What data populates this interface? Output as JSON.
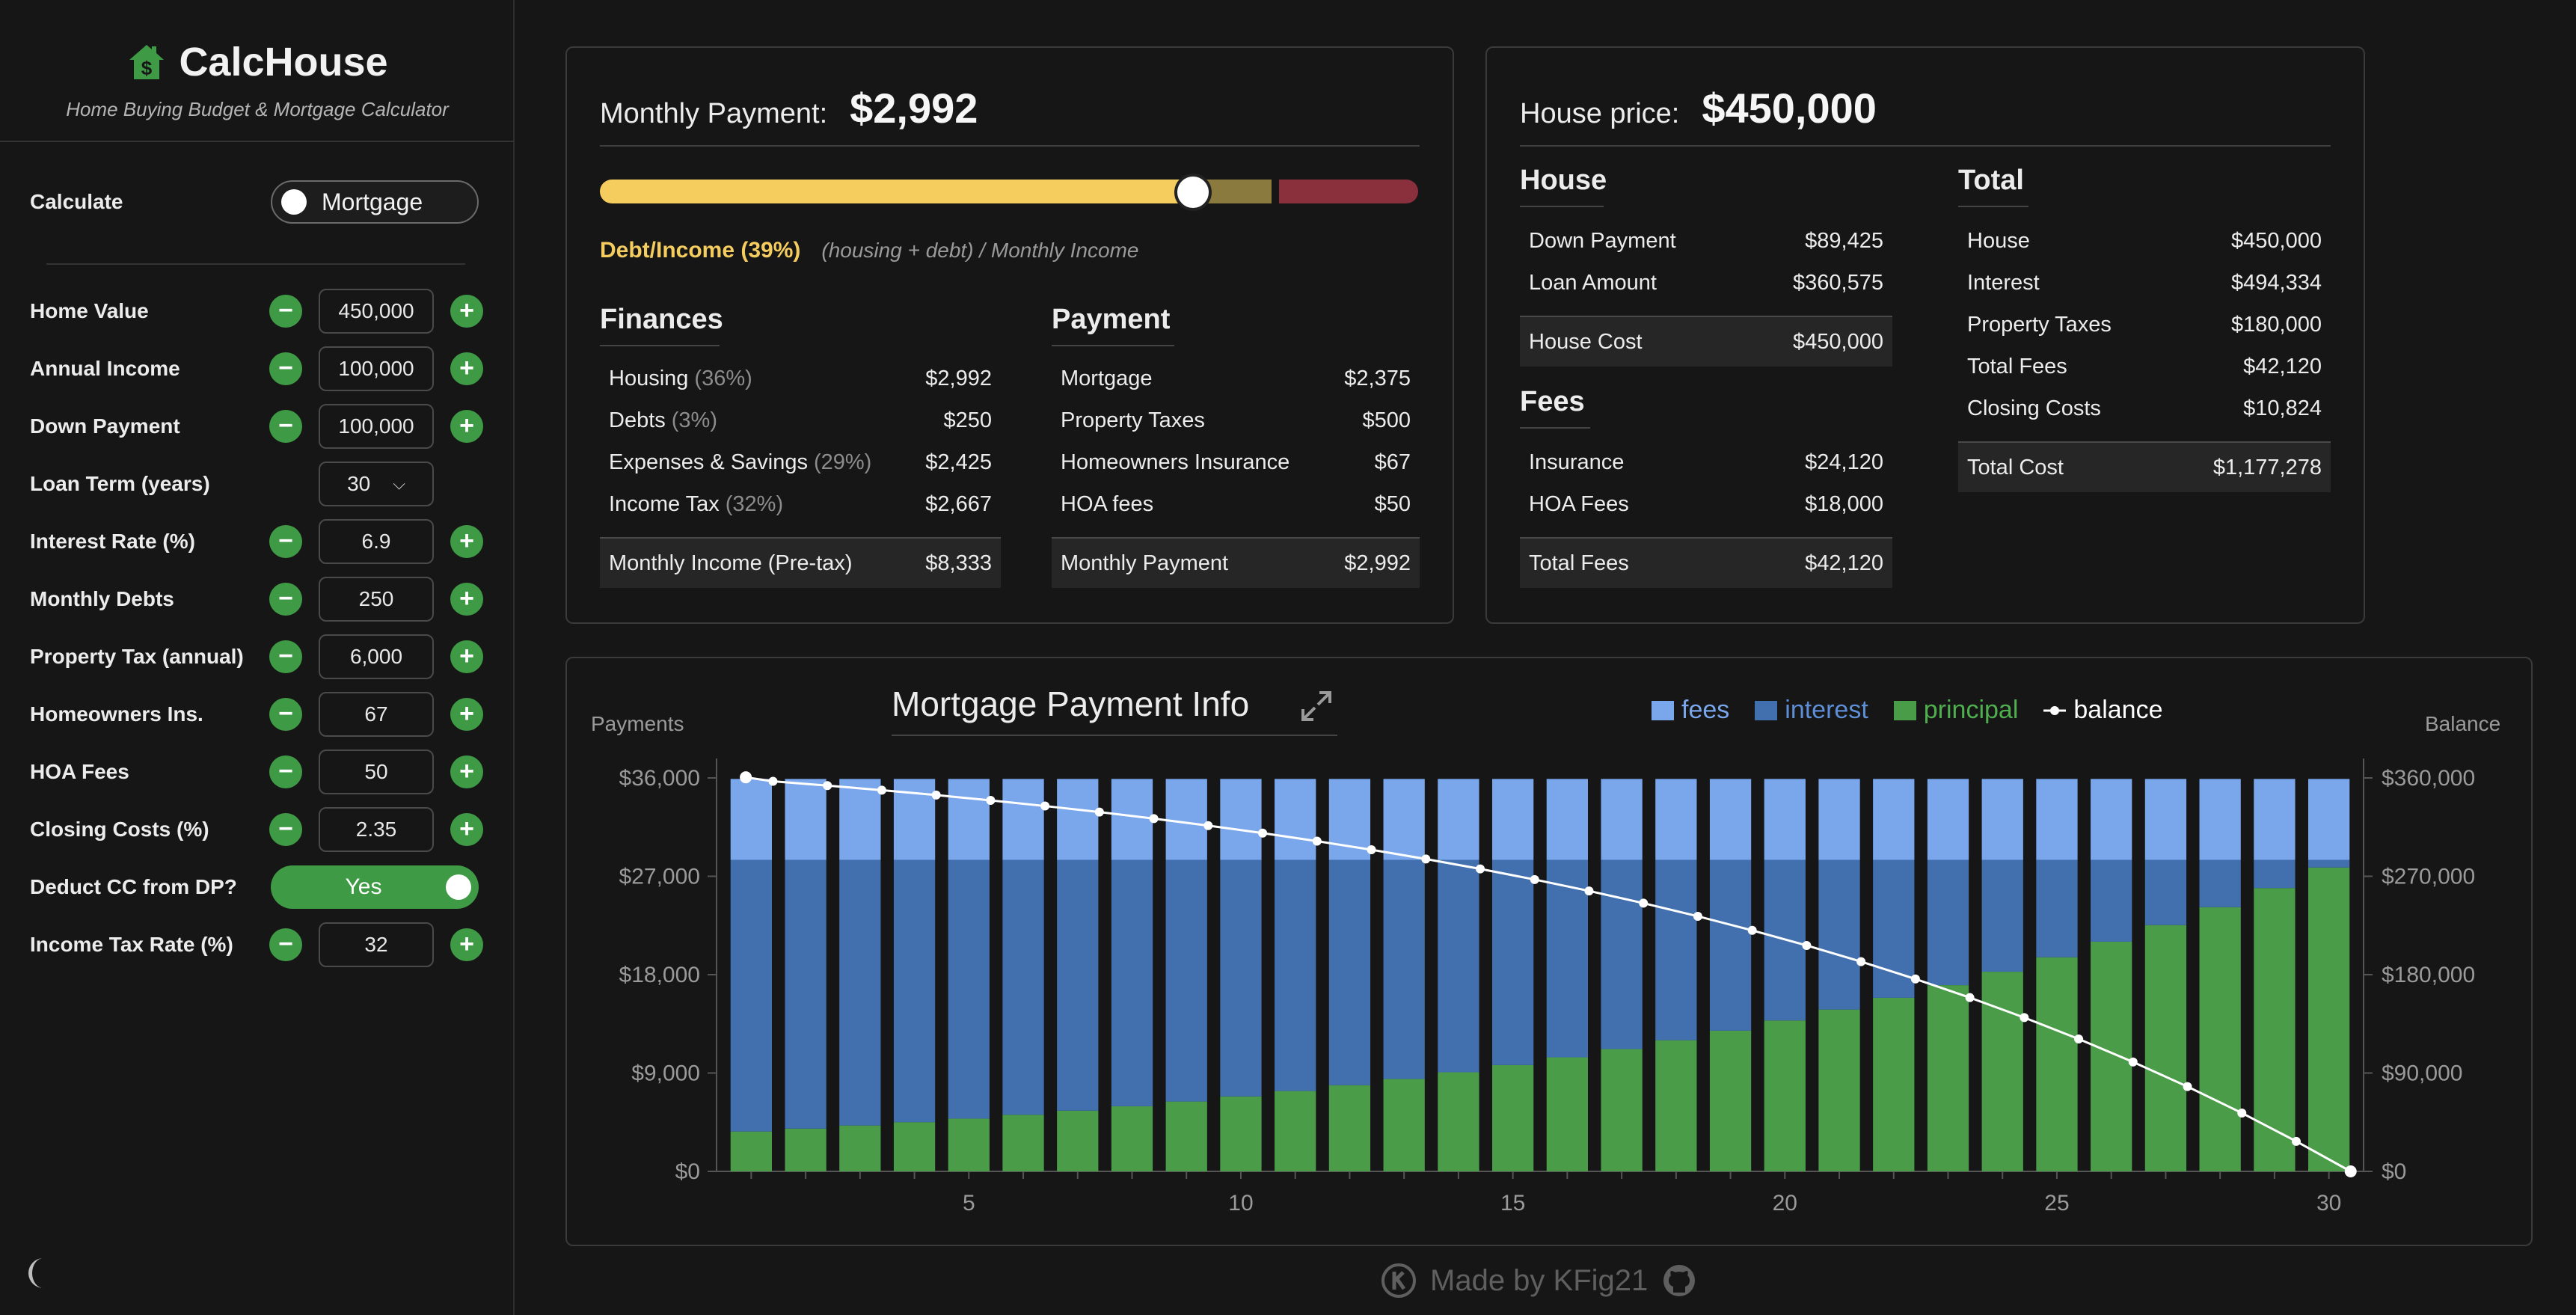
{
  "brand": {
    "name": "CalcHouse",
    "subtitle": "Home Buying Budget & Mortgage Calculator"
  },
  "sidebar": {
    "calculate": {
      "label": "Calculate",
      "mode": "Mortgage"
    },
    "fields": {
      "home_value": {
        "label": "Home Value",
        "value": "450,000"
      },
      "annual_income": {
        "label": "Annual Income",
        "value": "100,000"
      },
      "down_payment": {
        "label": "Down Payment",
        "value": "100,000"
      },
      "loan_term": {
        "label": "Loan Term (years)",
        "value": "30"
      },
      "interest_rate": {
        "label": "Interest Rate (%)",
        "value": "6.9"
      },
      "monthly_debts": {
        "label": "Monthly Debts",
        "value": "250"
      },
      "property_tax": {
        "label": "Property Tax (annual)",
        "value": "6,000"
      },
      "homeowners_ins": {
        "label": "Homeowners Ins.",
        "value": "67"
      },
      "hoa_fees": {
        "label": "HOA Fees",
        "value": "50"
      },
      "closing_costs": {
        "label": "Closing Costs (%)",
        "value": "2.35"
      },
      "deduct_cc": {
        "label": "Deduct CC from DP?",
        "value": "Yes"
      },
      "income_tax_rate": {
        "label": "Income Tax Rate (%)",
        "value": "32"
      }
    }
  },
  "payment_panel": {
    "label": "Monthly Payment:",
    "value": "$2,992",
    "dti_label": "Debt/Income (39%)",
    "dti_note": "(housing + debt) / Monthly Income",
    "dti_percent": 39,
    "finances": {
      "title": "Finances",
      "rows": [
        {
          "label": "Housing",
          "pct": "(36%)",
          "value": "$2,992"
        },
        {
          "label": "Debts",
          "pct": "(3%)",
          "value": "$250"
        },
        {
          "label": "Expenses & Savings",
          "pct": "(29%)",
          "value": "$2,425"
        },
        {
          "label": "Income Tax",
          "pct": "(32%)",
          "value": "$2,667"
        }
      ],
      "total": {
        "label": "Monthly Income (Pre-tax)",
        "value": "$8,333"
      }
    },
    "payment": {
      "title": "Payment",
      "rows": [
        {
          "label": "Mortgage",
          "value": "$2,375"
        },
        {
          "label": "Property Taxes",
          "value": "$500"
        },
        {
          "label": "Homeowners Insurance",
          "value": "$67"
        },
        {
          "label": "HOA fees",
          "value": "$50"
        }
      ],
      "total": {
        "label": "Monthly Payment",
        "value": "$2,992"
      }
    }
  },
  "house_panel": {
    "label": "House price:",
    "value": "$450,000",
    "house": {
      "title": "House",
      "rows": [
        {
          "label": "Down Payment",
          "value": "$89,425"
        },
        {
          "label": "Loan Amount",
          "value": "$360,575"
        }
      ],
      "total": {
        "label": "House Cost",
        "value": "$450,000"
      }
    },
    "fees": {
      "title": "Fees",
      "rows": [
        {
          "label": "Insurance",
          "value": "$24,120"
        },
        {
          "label": "HOA Fees",
          "value": "$18,000"
        }
      ],
      "total": {
        "label": "Total Fees",
        "value": "$42,120"
      }
    },
    "total": {
      "title": "Total",
      "rows": [
        {
          "label": "House",
          "value": "$450,000"
        },
        {
          "label": "Interest",
          "value": "$494,334"
        },
        {
          "label": "Property Taxes",
          "value": "$180,000"
        },
        {
          "label": "Total Fees",
          "value": "$42,120"
        },
        {
          "label": "Closing Costs",
          "value": "$10,824"
        }
      ],
      "total": {
        "label": "Total Cost",
        "value": "$1,177,278"
      }
    }
  },
  "chart": {
    "title": "Mortgage Payment Info",
    "left_axis_title": "Payments",
    "right_axis_title": "Balance",
    "legend": [
      {
        "name": "fees",
        "color": "#7aa7ec"
      },
      {
        "name": "interest",
        "color": "#426fae"
      },
      {
        "name": "principal",
        "color": "#4a9c49"
      },
      {
        "name": "balance",
        "color": "#ffffff"
      }
    ]
  },
  "chart_data": {
    "type": "bar",
    "stacked": true,
    "x": [
      1,
      2,
      3,
      4,
      5,
      6,
      7,
      8,
      9,
      10,
      11,
      12,
      13,
      14,
      15,
      16,
      17,
      18,
      19,
      20,
      21,
      22,
      23,
      24,
      25,
      26,
      27,
      28,
      29,
      30
    ],
    "x_ticks": [
      "5",
      "10",
      "15",
      "20",
      "25",
      "30"
    ],
    "y_left_ticks": [
      "$0",
      "$9,000",
      "$18,000",
      "$27,000",
      "$36,000"
    ],
    "y_right_ticks": [
      "$0",
      "$90,000",
      "$180,000",
      "$270,000",
      "$360,000"
    ],
    "ylim_left": [
      0,
      36000
    ],
    "ylim_right": [
      0,
      360000
    ],
    "series": [
      {
        "name": "principal",
        "axis": "left",
        "values": [
          3650,
          3915,
          4199,
          4503,
          4830,
          5181,
          5557,
          5960,
          6392,
          6856,
          7353,
          7886,
          8458,
          9071,
          9729,
          10435,
          11191,
          12003,
          12873,
          13807,
          14808,
          15882,
          17034,
          18269,
          19593,
          21014,
          22538,
          24172,
          25925,
          27805
        ]
      },
      {
        "name": "interest",
        "axis": "left",
        "values": [
          24855,
          24590,
          24306,
          24002,
          23675,
          23324,
          22948,
          22545,
          22113,
          21649,
          21152,
          20619,
          20047,
          19434,
          18776,
          18070,
          17314,
          16502,
          15632,
          14698,
          13697,
          12623,
          11471,
          10236,
          8912,
          7491,
          5967,
          4333,
          2580,
          700
        ]
      },
      {
        "name": "fees",
        "axis": "left",
        "values": [
          7404,
          7404,
          7404,
          7404,
          7404,
          7404,
          7404,
          7404,
          7404,
          7404,
          7404,
          7404,
          7404,
          7404,
          7404,
          7404,
          7404,
          7404,
          7404,
          7404,
          7404,
          7404,
          7404,
          7404,
          7404,
          7404,
          7404,
          7404,
          7404,
          7404
        ]
      },
      {
        "name": "balance",
        "type": "line",
        "axis": "right",
        "values": [
          356925,
          353010,
          348811,
          344308,
          339478,
          334297,
          328740,
          322780,
          316388,
          309532,
          302179,
          294293,
          285835,
          276764,
          267035,
          256600,
          245409,
          233406,
          220533,
          206726,
          191918,
          176036,
          159002,
          140733,
          121140,
          100126,
          77588,
          53416,
          27491,
          0
        ]
      }
    ]
  }
}
